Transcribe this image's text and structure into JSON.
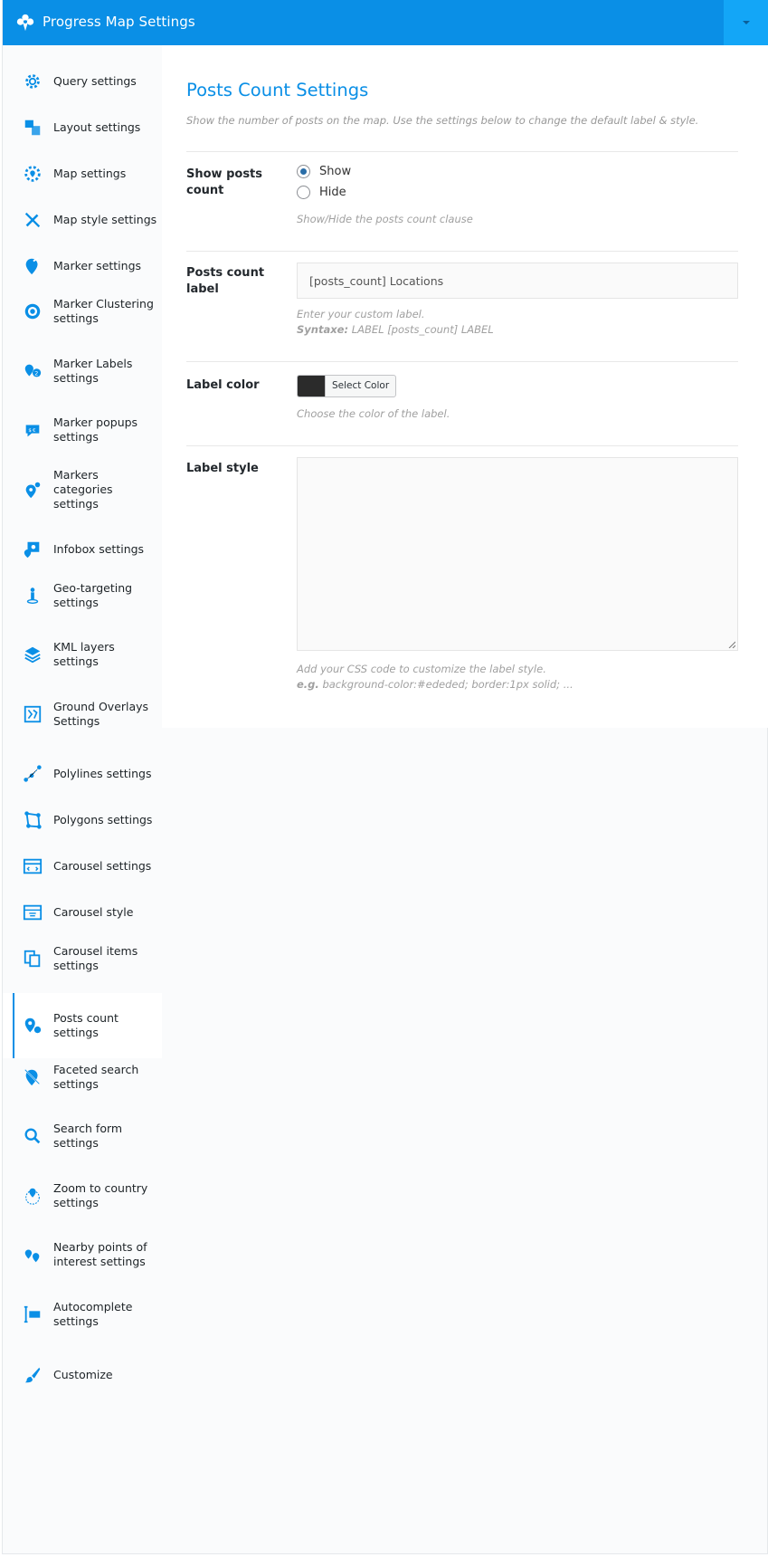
{
  "window": {
    "title": "Progress Map Settings"
  },
  "sidebar": {
    "items": [
      {
        "label": "Query settings",
        "icon": "gear-icon",
        "top": 0,
        "h": 49
      },
      {
        "label": "Layout settings",
        "icon": "layout-icon"
      },
      {
        "label": "Map settings",
        "icon": "map-gear-icon"
      },
      {
        "label": "Map style settings",
        "icon": "pencil-ruler-icon"
      },
      {
        "label": "Marker settings",
        "icon": "marker-pencil-icon"
      },
      {
        "label": "Marker Clustering settings",
        "icon": "target-icon"
      },
      {
        "label": "Marker Labels settings",
        "icon": "marker-labels-icon"
      },
      {
        "label": "Marker popups settings",
        "icon": "speech-bubble-icon"
      },
      {
        "label": "Markers categories settings",
        "icon": "marker-categories-icon"
      },
      {
        "label": "Infobox settings",
        "icon": "infobox-icon"
      },
      {
        "label": "Geo-targeting settings",
        "icon": "person-pin-icon"
      },
      {
        "label": "KML layers settings",
        "icon": "layers-icon"
      },
      {
        "label": "Ground Overlays Settings",
        "icon": "map-overlay-icon"
      },
      {
        "label": "Polylines settings",
        "icon": "polyline-icon"
      },
      {
        "label": "Polygons settings",
        "icon": "polygon-icon"
      },
      {
        "label": "Carousel settings",
        "icon": "carousel-icon"
      },
      {
        "label": "Carousel style",
        "icon": "carousel-style-icon"
      },
      {
        "label": "Carousel items settings",
        "icon": "copy-icon"
      },
      {
        "label": "Posts count settings",
        "icon": "marker-count-icon",
        "active": true
      },
      {
        "label": "Faceted search settings",
        "icon": "marker-slash-icon"
      },
      {
        "label": "Search form settings",
        "icon": "magnifier-icon"
      },
      {
        "label": "Zoom to country settings",
        "icon": "globe-marker-icon"
      },
      {
        "label": "Nearby points of interest settings",
        "icon": "nearby-markers-icon"
      },
      {
        "label": "Autocomplete settings",
        "icon": "autocomplete-icon"
      },
      {
        "label": "Customize",
        "icon": "brush-icon"
      }
    ]
  },
  "main": {
    "title": "Posts Count Settings",
    "description": "Show the number of posts on the map. Use the settings below to change the default label & style.",
    "show_posts_count": {
      "label": "Show posts count",
      "options": [
        "Show",
        "Hide"
      ],
      "selected": "Show",
      "help": "Show/Hide the posts count clause"
    },
    "posts_count_label": {
      "label": "Posts count label",
      "value": "[posts_count] Locations",
      "help": "Enter your custom label.",
      "syntax_label": "Syntaxe:",
      "syntax_value": "LABEL [posts_count] LABEL"
    },
    "label_color": {
      "label": "Label color",
      "button": "Select Color",
      "color": "#2b2b2b",
      "help": "Choose the color of the label."
    },
    "label_style": {
      "label": "Label style",
      "value": "",
      "help": "Add your CSS code to customize the label style.",
      "example_label": "e.g.",
      "example_value": "background-color:#ededed; border:1px solid; ..."
    }
  },
  "colors": {
    "accent": "#0a8fe6",
    "topbar": "#0a8fe6"
  }
}
